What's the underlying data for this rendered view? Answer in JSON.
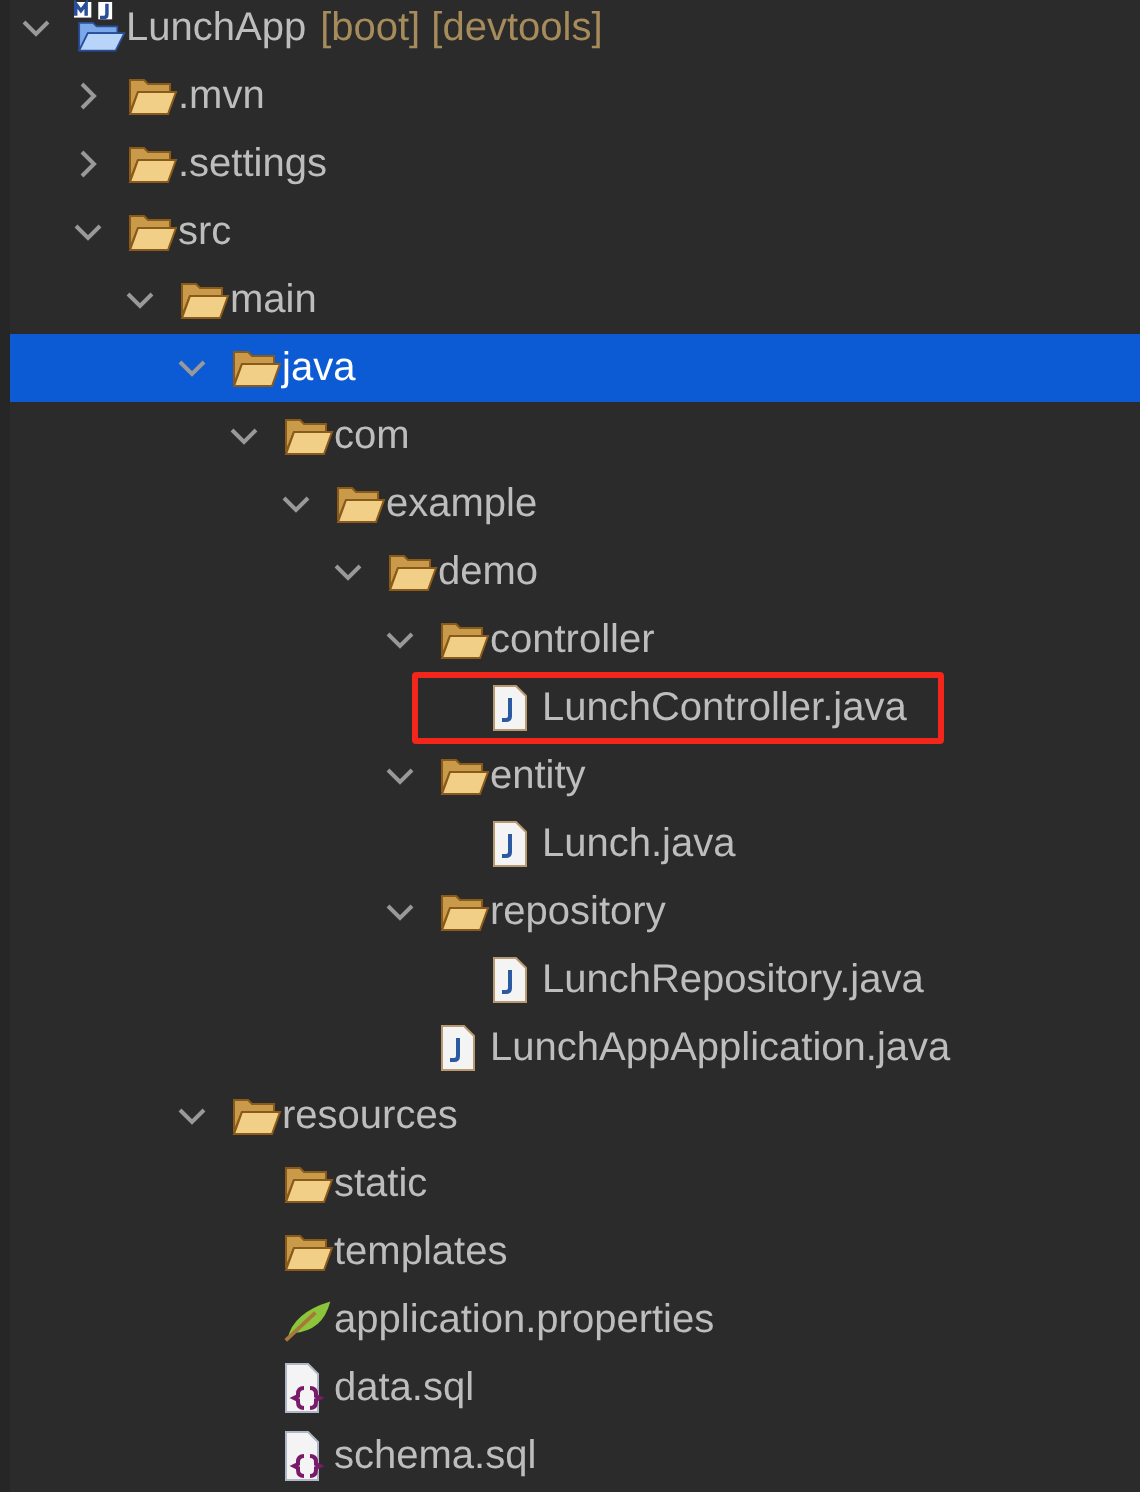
{
  "tree": [
    {
      "kind": "project",
      "label": "LunchApp",
      "decoration": "[boot] [devtools]",
      "expanded": true,
      "selected": false,
      "children": [
        {
          "kind": "folder",
          "label": ".mvn",
          "expanded": false,
          "selected": false
        },
        {
          "kind": "folder",
          "label": ".settings",
          "expanded": false,
          "selected": false
        },
        {
          "kind": "folder",
          "label": "src",
          "expanded": true,
          "selected": false,
          "children": [
            {
              "kind": "folder",
              "label": "main",
              "expanded": true,
              "selected": false,
              "children": [
                {
                  "kind": "folder",
                  "label": "java",
                  "expanded": true,
                  "selected": true,
                  "children": [
                    {
                      "kind": "folder",
                      "label": "com",
                      "expanded": true,
                      "selected": false,
                      "children": [
                        {
                          "kind": "folder",
                          "label": "example",
                          "expanded": true,
                          "selected": false,
                          "children": [
                            {
                              "kind": "folder",
                              "label": "demo",
                              "expanded": true,
                              "selected": false,
                              "children": [
                                {
                                  "kind": "folder",
                                  "label": "controller",
                                  "expanded": true,
                                  "selected": false,
                                  "children": [
                                    {
                                      "kind": "java",
                                      "label": "LunchController.java",
                                      "selected": false,
                                      "marked": true
                                    }
                                  ]
                                },
                                {
                                  "kind": "folder",
                                  "label": "entity",
                                  "expanded": true,
                                  "selected": false,
                                  "children": [
                                    {
                                      "kind": "java",
                                      "label": "Lunch.java",
                                      "selected": false
                                    }
                                  ]
                                },
                                {
                                  "kind": "folder",
                                  "label": "repository",
                                  "expanded": true,
                                  "selected": false,
                                  "children": [
                                    {
                                      "kind": "java",
                                      "label": "LunchRepository.java",
                                      "selected": false
                                    }
                                  ]
                                },
                                {
                                  "kind": "java",
                                  "label": "LunchAppApplication.java",
                                  "selected": false
                                }
                              ]
                            }
                          ]
                        }
                      ]
                    }
                  ]
                },
                {
                  "kind": "folder",
                  "label": "resources",
                  "expanded": true,
                  "selected": false,
                  "children": [
                    {
                      "kind": "folder",
                      "label": "static",
                      "selected": false
                    },
                    {
                      "kind": "folder",
                      "label": "templates",
                      "selected": false
                    },
                    {
                      "kind": "properties",
                      "label": "application.properties",
                      "selected": false
                    },
                    {
                      "kind": "sql",
                      "label": "data.sql",
                      "selected": false
                    },
                    {
                      "kind": "sql",
                      "label": "schema.sql",
                      "selected": false
                    }
                  ]
                }
              ]
            }
          ]
        }
      ]
    }
  ]
}
